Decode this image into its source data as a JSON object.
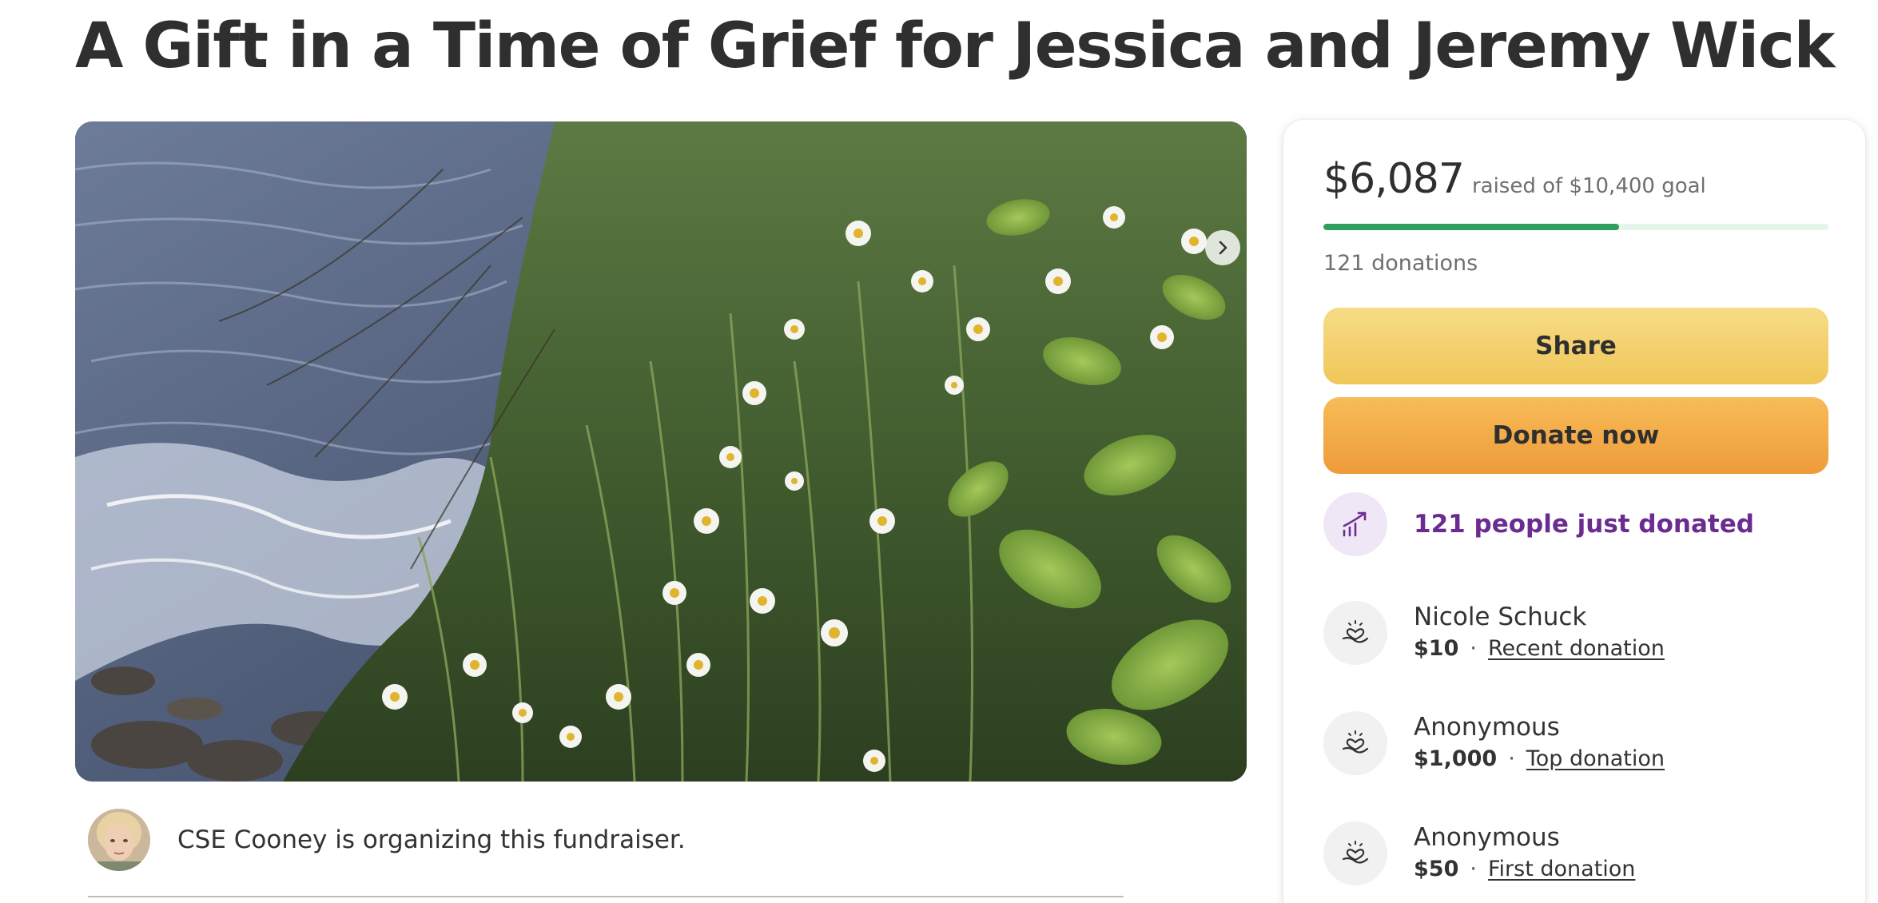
{
  "campaign": {
    "title": "A Gift in a Time of Grief for Jessica and Jeremy Wick"
  },
  "hero": {
    "image_alt": "Wildflowers and daisies on a rocky seaside cliff",
    "next_icon": "chevron-right-icon"
  },
  "organizer": {
    "text": "CSE Cooney is organizing this fundraiser."
  },
  "progress": {
    "raised": "$6,087",
    "goal_text": "raised of $10,400 goal",
    "fraction": 0.585,
    "donations_count": "121 donations"
  },
  "actions": {
    "share_label": "Share",
    "donate_label": "Donate now"
  },
  "activity": {
    "trend_text": "121 people just donated",
    "trend_icon": "trending-up-icon"
  },
  "donations": [
    {
      "name": "Nicole Schuck",
      "amount": "$10",
      "tag": "Recent donation",
      "icon": "heart-hand-icon"
    },
    {
      "name": "Anonymous",
      "amount": "$1,000",
      "tag": "Top donation",
      "icon": "heart-hand-icon"
    },
    {
      "name": "Anonymous",
      "amount": "$50",
      "tag": "First donation",
      "icon": "heart-hand-icon"
    }
  ],
  "colors": {
    "progress_fill": "#2f9e5e",
    "progress_track": "#e5f5ec",
    "share_button": "#f3cf6c",
    "donate_button": "#f2a947",
    "trend_text": "#6b2c91"
  }
}
